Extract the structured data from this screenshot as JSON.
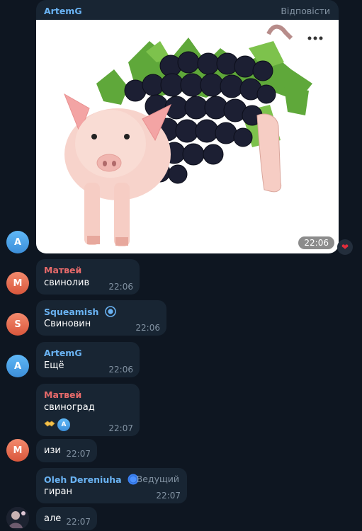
{
  "colors": {
    "background": "#0e1621",
    "bubble": "#182533",
    "name_blue": "#6ab3f3",
    "name_red": "#e76a6a",
    "timestamp": "#8393a3",
    "heart": "#e02c3b"
  },
  "messages": [
    {
      "id": "m1",
      "sender": "ArtemG",
      "sender_color": "#6ab3f3",
      "reply_label": "Відповісти",
      "media": "pig-grapes-image",
      "time": "22:06",
      "reaction": "heart-icon",
      "avatar_letter": "A"
    },
    {
      "id": "m2",
      "sender": "Матвей",
      "sender_color": "#e76a6a",
      "text": "свинолив",
      "time": "22:06",
      "avatar_letter": "M"
    },
    {
      "id": "m3",
      "sender": "Squeamish",
      "sender_color": "#6ab3f3",
      "text": "Свиновин",
      "time": "22:06",
      "avatar_letter": "S"
    },
    {
      "id": "m4",
      "sender": "ArtemG",
      "sender_color": "#6ab3f3",
      "text": "Ещё",
      "time": "22:06",
      "avatar_letter": "A"
    },
    {
      "id": "m5",
      "sender": "Матвей",
      "sender_color": "#e76a6a",
      "text": "свиноград",
      "time": "22:07",
      "reaction_emoji": "handshake-icon",
      "reaction_avatar": "A"
    },
    {
      "id": "m6",
      "text": "изи",
      "time": "22:07",
      "avatar_letter": "M"
    },
    {
      "id": "m7",
      "sender": "Oleh Dereniuha",
      "sender_color": "#6ab3f3",
      "role": "Ведущий",
      "text": "гиран",
      "time": "22:07"
    },
    {
      "id": "m8",
      "text": "але",
      "time": "22:07"
    }
  ]
}
